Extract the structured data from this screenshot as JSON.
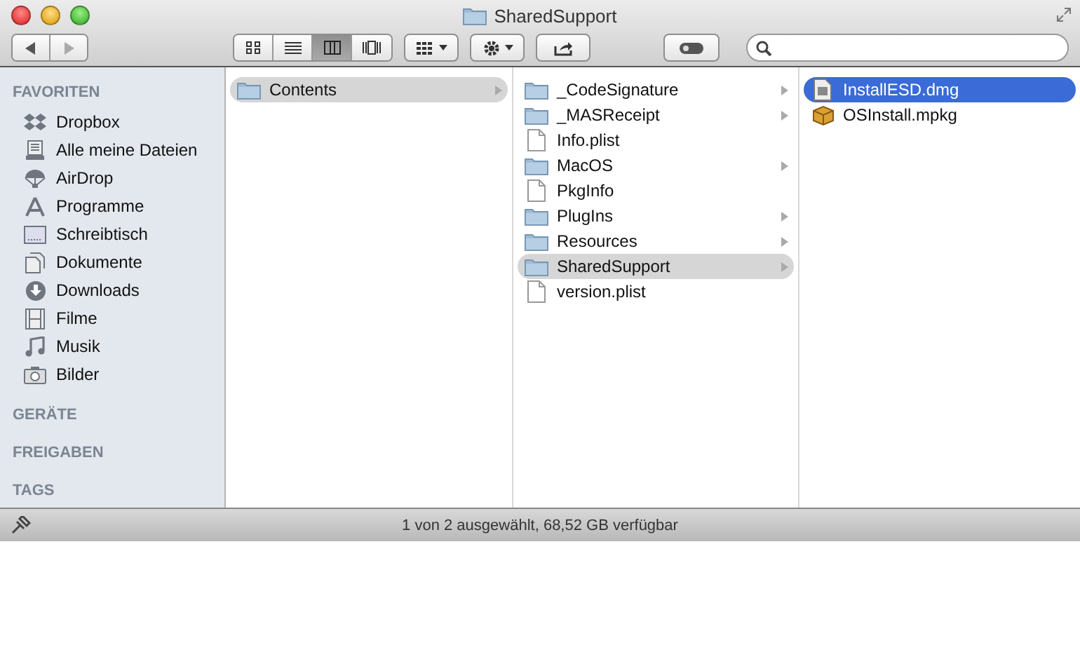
{
  "window": {
    "title": "SharedSupport"
  },
  "toolbar": {
    "view_buttons": [
      {
        "kind": "icons",
        "selected": false
      },
      {
        "kind": "list",
        "selected": false
      },
      {
        "kind": "columns",
        "selected": true
      },
      {
        "kind": "coverflow",
        "selected": false
      }
    ]
  },
  "sidebar": {
    "sections": [
      {
        "heading": "FAVORITEN",
        "items": [
          {
            "label": "Dropbox"
          },
          {
            "label": "Alle meine Dateien"
          },
          {
            "label": "AirDrop"
          },
          {
            "label": "Programme"
          },
          {
            "label": "Schreibtisch"
          },
          {
            "label": "Dokumente"
          },
          {
            "label": "Downloads"
          },
          {
            "label": "Filme"
          },
          {
            "label": "Musik"
          },
          {
            "label": "Bilder"
          }
        ]
      },
      {
        "heading": "GERÄTE"
      },
      {
        "heading": "FREIGABEN"
      },
      {
        "heading": "TAGS"
      }
    ]
  },
  "columns": [
    {
      "focused": false,
      "items": [
        {
          "name": "Contents",
          "kind": "folder",
          "expandable": true,
          "selected": true
        }
      ]
    },
    {
      "focused": false,
      "items": [
        {
          "name": "_CodeSignature",
          "kind": "folder",
          "expandable": true,
          "selected": false
        },
        {
          "name": "_MASReceipt",
          "kind": "folder",
          "expandable": true,
          "selected": false
        },
        {
          "name": "Info.plist",
          "kind": "file",
          "expandable": false,
          "selected": false
        },
        {
          "name": "MacOS",
          "kind": "folder",
          "expandable": true,
          "selected": false
        },
        {
          "name": "PkgInfo",
          "kind": "file",
          "expandable": false,
          "selected": false
        },
        {
          "name": "PlugIns",
          "kind": "folder",
          "expandable": true,
          "selected": false
        },
        {
          "name": "Resources",
          "kind": "folder",
          "expandable": true,
          "selected": false
        },
        {
          "name": "SharedSupport",
          "kind": "folder",
          "expandable": true,
          "selected": true
        },
        {
          "name": "version.plist",
          "kind": "file",
          "expandable": false,
          "selected": false
        }
      ]
    },
    {
      "focused": true,
      "items": [
        {
          "name": "InstallESD.dmg",
          "kind": "disk",
          "expandable": false,
          "selected": true
        },
        {
          "name": "OSInstall.mpkg",
          "kind": "package",
          "expandable": false,
          "selected": false
        }
      ]
    }
  ],
  "status_bar": {
    "text": "1 von 2 ausgewählt, 68,52 GB verfügbar"
  }
}
